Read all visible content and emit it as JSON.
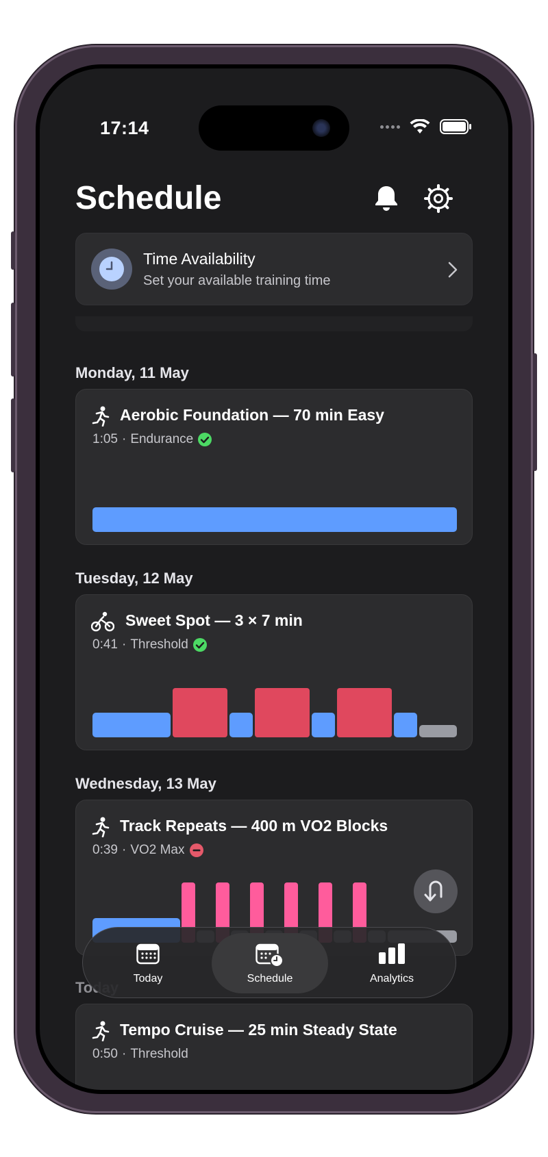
{
  "status": {
    "time": "17:14"
  },
  "header": {
    "title": "Schedule"
  },
  "availability": {
    "title": "Time Availability",
    "subtitle": "Set your available training time"
  },
  "days": [
    {
      "label": "Monday, 11 May",
      "workout": {
        "sport": "run",
        "title": "Aerobic Foundation — 70 min Easy",
        "duration": "1:05",
        "type": "Endurance",
        "status": "completed"
      }
    },
    {
      "label": "Tuesday, 12 May",
      "workout": {
        "sport": "bike",
        "title": "Sweet Spot — 3 × 7 min",
        "duration": "0:41",
        "type": "Threshold",
        "status": "completed"
      }
    },
    {
      "label": "Wednesday, 13 May",
      "workout": {
        "sport": "run",
        "title": "Track Repeats — 400 m VO2 Blocks",
        "duration": "0:39",
        "type": "VO2 Max",
        "status": "missed"
      }
    },
    {
      "label": "Today",
      "workout": {
        "sport": "run",
        "title": "Tempo Cruise — 25 min Steady State",
        "duration": "0:50",
        "type": "Threshold"
      }
    }
  ],
  "meta_separator": "·",
  "colors": {
    "easy": "#5e9cff",
    "threshold": "#e0485e",
    "vo2": "#ff5c9c",
    "rest": "#9a9ca3",
    "ok": "#4cd964",
    "missed": "#e5596a"
  },
  "tabs": [
    {
      "label": "Today",
      "icon": "calendar-icon",
      "active": false
    },
    {
      "label": "Schedule",
      "icon": "calendar-clock-icon",
      "active": true
    },
    {
      "label": "Analytics",
      "icon": "bar-chart-icon",
      "active": false
    }
  ]
}
